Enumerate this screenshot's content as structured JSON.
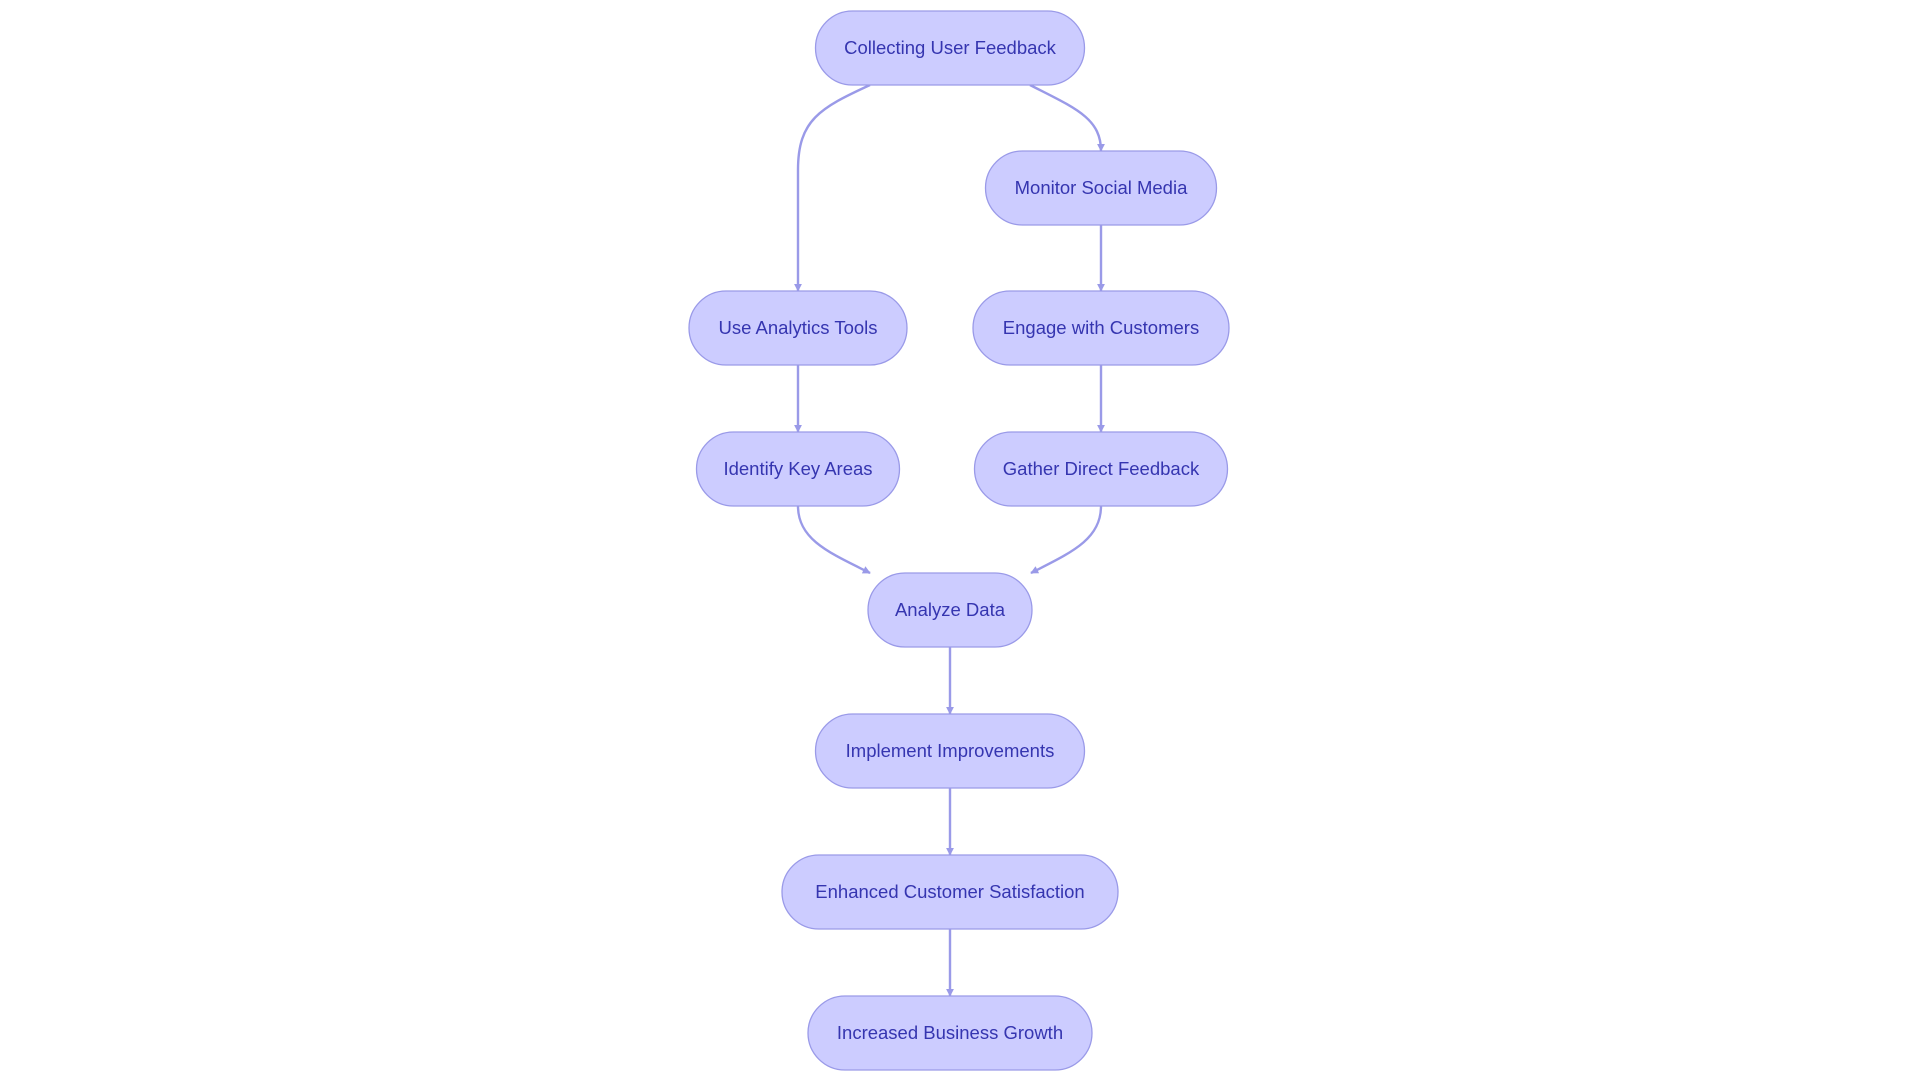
{
  "diagram": {
    "type": "flowchart",
    "colors": {
      "node_fill": "#ccccff",
      "node_stroke": "#9a9ae8",
      "text": "#3535b0",
      "edge": "#9a9ae8"
    },
    "nodes": [
      {
        "id": "collect",
        "label": "Collecting User Feedback"
      },
      {
        "id": "monitor",
        "label": "Monitor Social Media"
      },
      {
        "id": "analytics",
        "label": "Use Analytics Tools"
      },
      {
        "id": "engage",
        "label": "Engage with Customers"
      },
      {
        "id": "identify",
        "label": "Identify Key Areas"
      },
      {
        "id": "gather",
        "label": "Gather Direct Feedback"
      },
      {
        "id": "analyze",
        "label": "Analyze Data"
      },
      {
        "id": "implement",
        "label": "Implement Improvements"
      },
      {
        "id": "enhanced",
        "label": "Enhanced Customer Satisfaction"
      },
      {
        "id": "growth",
        "label": "Increased Business Growth"
      }
    ],
    "edges": [
      {
        "from": "collect",
        "to": "analytics"
      },
      {
        "from": "collect",
        "to": "monitor"
      },
      {
        "from": "monitor",
        "to": "engage"
      },
      {
        "from": "analytics",
        "to": "identify"
      },
      {
        "from": "engage",
        "to": "gather"
      },
      {
        "from": "identify",
        "to": "analyze"
      },
      {
        "from": "gather",
        "to": "analyze"
      },
      {
        "from": "analyze",
        "to": "implement"
      },
      {
        "from": "implement",
        "to": "enhanced"
      },
      {
        "from": "enhanced",
        "to": "growth"
      }
    ]
  }
}
